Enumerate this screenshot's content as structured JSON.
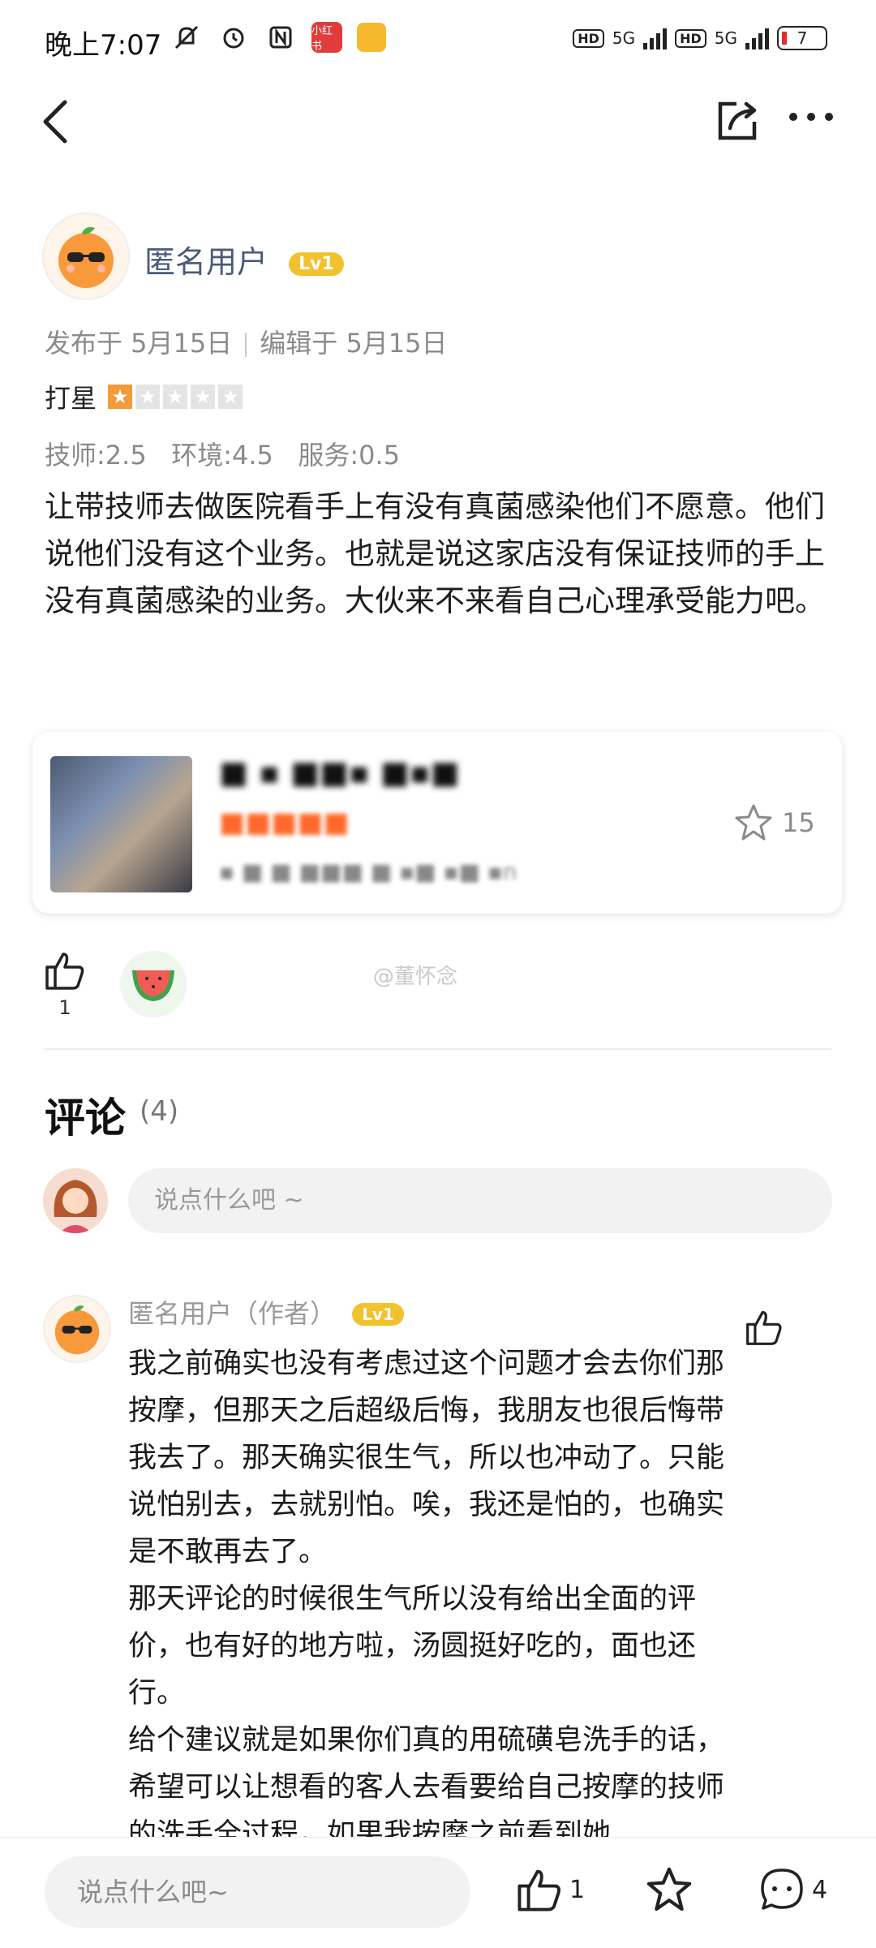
{
  "status_bar": {
    "time": "晚上7:07",
    "app_badge": "小红书",
    "network_a": "5G",
    "network_b": "5G",
    "hd": "HD",
    "battery": "7"
  },
  "post": {
    "author": "匿名用户",
    "level": "Lv1",
    "published": "发布于 5月15日",
    "edited": "编辑于 5月15日",
    "rating_label": "打星",
    "rating": 1,
    "rating_max": 5,
    "scores": "技师:2.5   环境:4.5   服务:0.5",
    "body": "让带技师去做医院看手上有没有真菌感染他们不愿意。他们说他们没有这个业务。也就是说这家店没有保证技师的手上没有真菌感染的业务。大伙来不来看自己心理承受能力吧。",
    "likes": "1",
    "watermark": "@董怀念"
  },
  "shop_card": {
    "name": "■ ▪ ■■▪ ■▪■",
    "price": "■■■■■",
    "address": "▪ ■ ■ ■■■ ■ ▪■ ▪■ ▪n",
    "favorites": "15"
  },
  "comments": {
    "title": "评论",
    "count": "(4)",
    "input_placeholder": "说点什么吧 ~",
    "items": [
      {
        "author": "匿名用户（作者）",
        "level": "Lv1",
        "paragraphs": [
          "我之前确实也没有考虑过这个问题才会去你们那按摩，但那天之后超级后悔，我朋友也很后悔带我去了。那天确实很生气，所以也冲动了。只能说怕别去，去就别怕。唉，我还是怕的，也确实是不敢再去了。",
          "那天评论的时候很生气所以没有给出全面的评价，也有好的地方啦，汤圆挺好吃的，面也还行。",
          "给个建议就是如果你们真的用硫磺皂洗手的话，希望可以让想看的客人去看要给自己按摩的技师的洗手全过程，如果我按摩之前看到她"
        ]
      }
    ]
  },
  "bottom_bar": {
    "input_placeholder": "说点什么吧~",
    "likes": "1",
    "comments": "4"
  }
}
